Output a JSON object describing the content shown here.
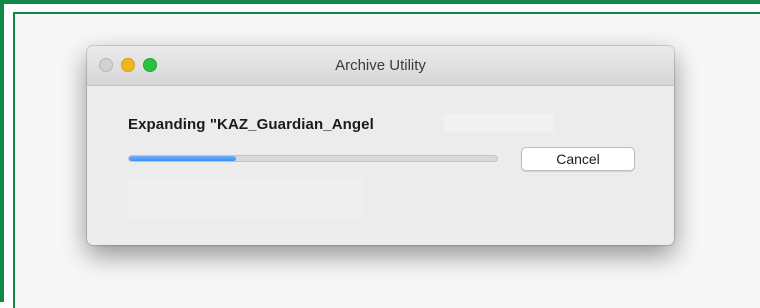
{
  "window": {
    "title": "Archive Utility",
    "heading": "Expanding \"KAZ_Guardian_Angel",
    "progress_percent": 29,
    "cancel_label": "Cancel"
  },
  "colors": {
    "frame_border": "#108846",
    "progress_fill": "#3b8ef2",
    "close_button": "#d1d1d1",
    "minimize_button": "#f3b51d",
    "zoom_button": "#2ec140"
  }
}
